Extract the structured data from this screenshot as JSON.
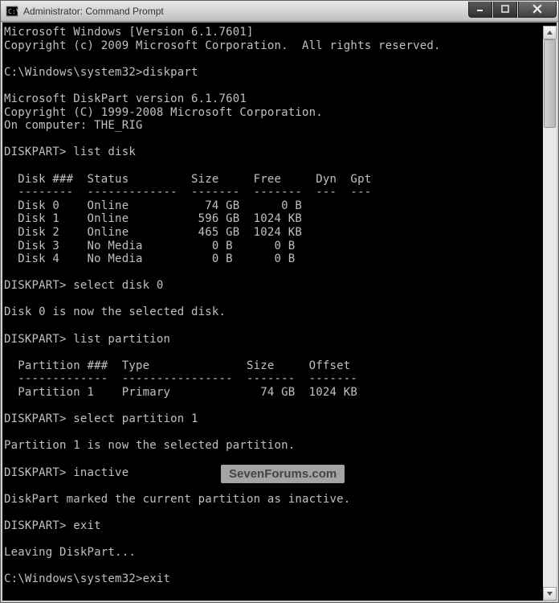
{
  "window": {
    "title": "Administrator: Command Prompt"
  },
  "terminal": {
    "lines": [
      "Microsoft Windows [Version 6.1.7601]",
      "Copyright (c) 2009 Microsoft Corporation.  All rights reserved.",
      "",
      "C:\\Windows\\system32>diskpart",
      "",
      "Microsoft DiskPart version 6.1.7601",
      "Copyright (C) 1999-2008 Microsoft Corporation.",
      "On computer: THE_RIG",
      "",
      "DISKPART> list disk",
      "",
      "  Disk ###  Status         Size     Free     Dyn  Gpt",
      "  --------  -------------  -------  -------  ---  ---",
      "  Disk 0    Online           74 GB      0 B",
      "  Disk 1    Online          596 GB  1024 KB",
      "  Disk 2    Online          465 GB  1024 KB",
      "  Disk 3    No Media          0 B      0 B",
      "  Disk 4    No Media          0 B      0 B",
      "",
      "DISKPART> select disk 0",
      "",
      "Disk 0 is now the selected disk.",
      "",
      "DISKPART> list partition",
      "",
      "  Partition ###  Type              Size     Offset",
      "  -------------  ----------------  -------  -------",
      "  Partition 1    Primary             74 GB  1024 KB",
      "",
      "DISKPART> select partition 1",
      "",
      "Partition 1 is now the selected partition.",
      "",
      "DISKPART> inactive",
      "",
      "DiskPart marked the current partition as inactive.",
      "",
      "DISKPART> exit",
      "",
      "Leaving DiskPart...",
      "",
      "C:\\Windows\\system32>exit"
    ]
  },
  "watermark": "SevenForums.com"
}
